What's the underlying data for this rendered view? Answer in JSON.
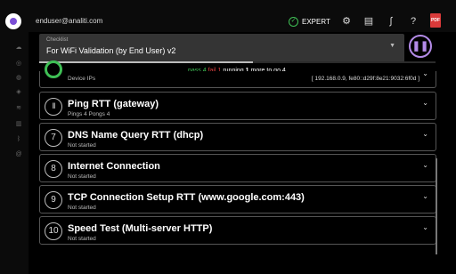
{
  "header": {
    "user_email": "enduser@analiti.com",
    "expert_label": "EXPERT",
    "icons": [
      "app-logo-icon",
      "gear-icon",
      "feedback-icon",
      "graph-icon",
      "help-icon",
      "pdf-icon"
    ],
    "pdf_label": "PDF"
  },
  "sidebar": {
    "icons": [
      "cloud-icon",
      "check-circle-icon",
      "globe-icon",
      "shield-icon",
      "wifi-icon",
      "bar-chart-icon",
      "bluetooth-icon",
      "at-icon"
    ]
  },
  "checklist": {
    "label": "Checklist",
    "value": "For WiFi Validation (by End User) v2"
  },
  "progress": {
    "fraction": 0.54
  },
  "status": {
    "pass": "pass 4",
    "fail": "fail 1",
    "running_prefix": "running",
    "running_count": "1",
    "more": "more to go",
    "more_count": "4"
  },
  "items": [
    {
      "num": "",
      "title": "",
      "subtitle": "Device IPs",
      "detail": "[ 192.168.0.9, fe80::d29f:8e21:9032:6f0d ]"
    },
    {
      "num": "II",
      "title": "Ping RTT (gateway)",
      "subtitle": "Pings 4 Pongs 4"
    },
    {
      "num": "7",
      "title": "DNS Name Query RTT (dhcp)",
      "subtitle": "Not started"
    },
    {
      "num": "8",
      "title": "Internet Connection",
      "subtitle": "Not started"
    },
    {
      "num": "9",
      "title": "TCP Connection Setup RTT (www.google.com:443)",
      "subtitle": "Not started"
    },
    {
      "num": "10",
      "title": "Speed Test (Multi-server HTTP)",
      "subtitle": "Not started"
    }
  ],
  "colors": {
    "accent": "#b48be8",
    "pass": "#3fbf55",
    "fail": "#e04040"
  }
}
